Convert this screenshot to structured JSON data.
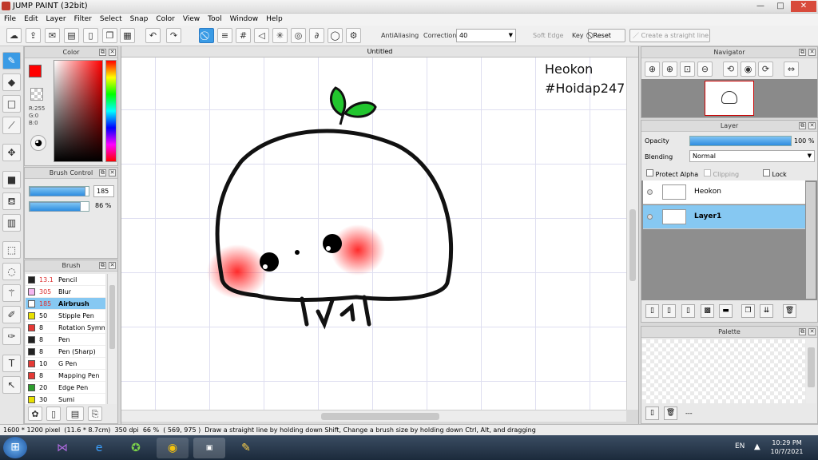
{
  "window": {
    "title": "JUMP PAINT (32bit)",
    "minimize": "—",
    "maximize": "□",
    "close": "✕"
  },
  "menu": [
    "File",
    "Edit",
    "Layer",
    "Filter",
    "Select",
    "Snap",
    "Color",
    "View",
    "Tool",
    "Window",
    "Help"
  ],
  "toolbar": {
    "antialiasing_label": "AntiAliasing",
    "correction_label": "Correction",
    "correction_value": "40",
    "soft_edge_label": "Soft Edge",
    "key_label": "Key",
    "reset_label": "Reset",
    "straight_line_label": "Create a straight line"
  },
  "color_panel": {
    "title": "Color",
    "r": "R:255",
    "g": "G:0",
    "b": "B:0",
    "fg": "#ff0000",
    "bg": "#ffffff"
  },
  "brush_control": {
    "title": "Brush Control",
    "size": "185",
    "opacity": "86 %",
    "size_fill": 0.95,
    "opacity_fill": 0.86
  },
  "brush": {
    "title": "Brush",
    "items": [
      {
        "size": "13.1",
        "name": "Pencil",
        "color": "#222222",
        "size_color": "#d33"
      },
      {
        "size": "305",
        "name": "Blur",
        "color": "#f5b6f0",
        "size_color": "#d33"
      },
      {
        "size": "185",
        "name": "Airbrush",
        "color": "#ffffff",
        "size_color": "#d33"
      },
      {
        "size": "50",
        "name": "Stipple Pen",
        "color": "#e8e000",
        "size_color": "#000"
      },
      {
        "size": "8",
        "name": "Rotation Symm",
        "color": "#e53935",
        "size_color": "#000"
      },
      {
        "size": "8",
        "name": "Pen",
        "color": "#222222",
        "size_color": "#000"
      },
      {
        "size": "8",
        "name": "Pen (Sharp)",
        "color": "#222222",
        "size_color": "#000"
      },
      {
        "size": "10",
        "name": "G Pen",
        "color": "#e53935",
        "size_color": "#000"
      },
      {
        "size": "8",
        "name": "Mapping Pen",
        "color": "#e53935",
        "size_color": "#000"
      },
      {
        "size": "20",
        "name": "Edge Pen",
        "color": "#2e9e2e",
        "size_color": "#000"
      },
      {
        "size": "30",
        "name": "Sumi",
        "color": "#e8e000",
        "size_color": "#000"
      }
    ]
  },
  "canvas": {
    "tab": "Untitled",
    "text1": "Heokon",
    "text2": "#Hoidap247"
  },
  "navigator": {
    "title": "Navigator"
  },
  "layer": {
    "title": "Layer",
    "opacity_label": "Opacity",
    "opacity_value": "100 %",
    "blending_label": "Blending",
    "blending_value": "Normal",
    "protect_alpha": "Protect Alpha",
    "clipping": "Clipping",
    "lock": "Lock",
    "layers": [
      {
        "name": "Heokon",
        "selected": false
      },
      {
        "name": "Layer1",
        "selected": true
      }
    ]
  },
  "palette": {
    "title": "Palette",
    "dots": "---"
  },
  "status": {
    "size": "1600 * 1200 pixel",
    "cm": "(11.6 * 8.7cm)",
    "dpi": "350 dpi",
    "zoom": "66 %",
    "coords": "( 569, 975 )",
    "hint": "Draw a straight line by holding down Shift, Change a brush size by holding down Ctrl, Alt, and dragging"
  },
  "taskbar": {
    "lang": "EN",
    "time": "10:29 PM",
    "date": "10/7/2021"
  }
}
